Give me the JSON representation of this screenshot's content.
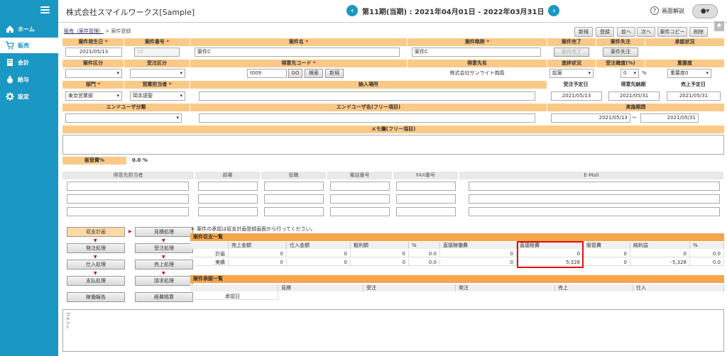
{
  "sidebar": {
    "items": [
      {
        "label": "ホーム",
        "icon": "home-icon"
      },
      {
        "label": "販売",
        "icon": "cart-icon"
      },
      {
        "label": "会計",
        "icon": "ledger-icon"
      },
      {
        "label": "給与",
        "icon": "moneybag-icon"
      },
      {
        "label": "設定",
        "icon": "gear-icon"
      }
    ]
  },
  "header": {
    "company": "株式会社スマイルワークス[Sample]",
    "period": "第11期(当期) : 2021年04月01日 - 2022年03月31日",
    "help": "画面解説"
  },
  "breadcrumb": {
    "parent": "販売（案件管理）",
    "sep": " > ",
    "current": "案件登録"
  },
  "toolbar": {
    "new": "新規",
    "register": "登録",
    "prev": "前へ",
    "next": "次へ",
    "copy": "案件コピー",
    "delete": "削除"
  },
  "row1": {
    "h_date": "案件発生日",
    "h_no": "案件番号",
    "h_name": "案件名",
    "h_short": "案件略称",
    "h_done": "案件完了",
    "h_lost": "案件失注",
    "h_approve": "承認状況",
    "date": "2021/05/13",
    "no": "10",
    "name": "案件C",
    "short": "案件C",
    "done_btn": "案件完了",
    "lost_btn": "案件失注"
  },
  "row2": {
    "h_kubun": "案件区分",
    "h_juchu": "受注区分",
    "h_code": "得意先コード",
    "h_cust": "得意先名",
    "h_prog": "進捗状況",
    "h_prob": "受注確度(%)",
    "h_imp": "重要度",
    "code": "t009",
    "go": "GO",
    "search": "検索",
    "new": "新規",
    "cust": "株式会社サンライト南風",
    "prog": "起案",
    "prob": "0",
    "pct": "%",
    "imp": "重要度0"
  },
  "row3": {
    "h_dept": "部門",
    "h_staff": "営業担当者",
    "h_place": "納入場所",
    "h_order_date": "受注予定日",
    "h_deliv": "得意先納期",
    "h_sales": "売上予定日",
    "dept": "東京営業部",
    "staff": "岡本語聖",
    "order_date": "2021/05/13",
    "deliv": "2021/05/31",
    "sales": "2021/05/31"
  },
  "row4": {
    "h_enduser": "エンドユーザ分類",
    "h_endname": "エンドユーザ名(フリー項目)",
    "h_period": "実施期間",
    "from": "2021/05/13",
    "tilde": "〜",
    "to": "2021/05/31"
  },
  "memo": {
    "header": "メモ欄(フリー項目)"
  },
  "sga": {
    "label": "販管費%",
    "value": "0.0 %"
  },
  "contacts": {
    "headers": [
      "得意先担当者",
      "部署",
      "役職",
      "電話番号",
      "FAX番号",
      "E-Mail"
    ]
  },
  "flow": {
    "plan": "収支計画",
    "estimate": "見積処理",
    "order": "発注処理",
    "receive": "受注処理",
    "purchase": "仕入処理",
    "sale": "売上処理",
    "pay": "支払処理",
    "invoice": "請求処理",
    "work": "稼働報告",
    "expense": "経費精算"
  },
  "note": "＊ 案件の承認は収支計画登録画面から行ってください。",
  "balance": {
    "title": "案件収支一覧",
    "headers": [
      "売上金額",
      "仕入金額",
      "粗利額",
      "%",
      "直接稼働費",
      "直接経費",
      "販管費",
      "純利益",
      "%"
    ],
    "rows": [
      {
        "label": "計画",
        "values": [
          "0",
          "0",
          "0",
          "0.0",
          "0",
          "0",
          "0",
          "0",
          "0.0"
        ]
      },
      {
        "label": "実績",
        "values": [
          "0",
          "0",
          "0",
          "0.0",
          "0",
          "5,328",
          "0",
          "-5,328",
          "0.0"
        ]
      }
    ]
  },
  "approval": {
    "title": "案件承認一覧",
    "headers": [
      "見積",
      "受注",
      "発注",
      "売上",
      "仕入"
    ],
    "row_label": "承認日"
  },
  "comment": {
    "label": "コメント"
  }
}
